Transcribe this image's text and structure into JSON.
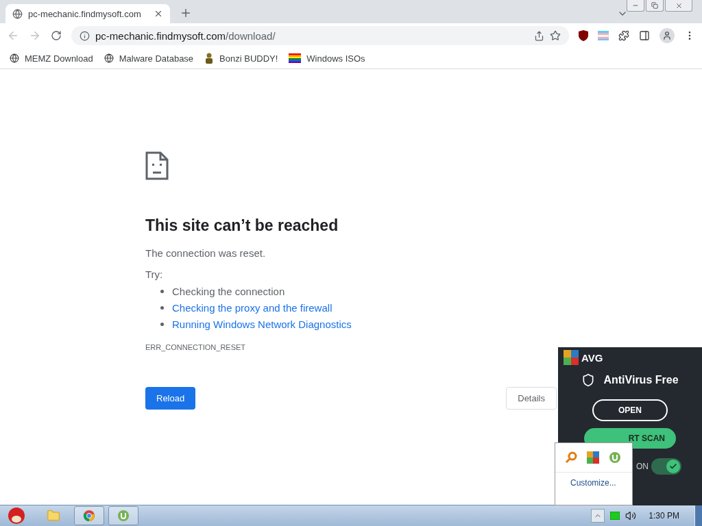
{
  "tab": {
    "title": "pc-mechanic.findmysoft.com",
    "selected": true
  },
  "address": {
    "host": "pc-mechanic.findmysoft.com",
    "path": "/download/"
  },
  "bookmarks": [
    {
      "label": "MEMZ Download",
      "kind": "globe"
    },
    {
      "label": "Malware Database",
      "kind": "globe"
    },
    {
      "label": "Bonzi BUDDY!",
      "kind": "figure"
    },
    {
      "label": "Windows ISOs",
      "kind": "rainbow"
    }
  ],
  "error": {
    "title": "This site can’t be reached",
    "message": "The connection was reset.",
    "try_label": "Try:",
    "suggestions": [
      {
        "text": "Checking the connection",
        "kind": "text"
      },
      {
        "text": "Checking the proxy and the firewall",
        "kind": "link"
      },
      {
        "text": "Running Windows Network Diagnostics",
        "kind": "link"
      }
    ],
    "code": "ERR_CONNECTION_RESET",
    "reload": "Reload",
    "details": "Details"
  },
  "avg": {
    "brand": "AVG",
    "product": "AntiVirus Free",
    "open": "OPEN",
    "scan": "RT SCAN",
    "toggle_label": "ON",
    "on": true
  },
  "tray_popup": {
    "customize": "Customize..."
  },
  "taskbar": {
    "time": "1:30 PM"
  }
}
